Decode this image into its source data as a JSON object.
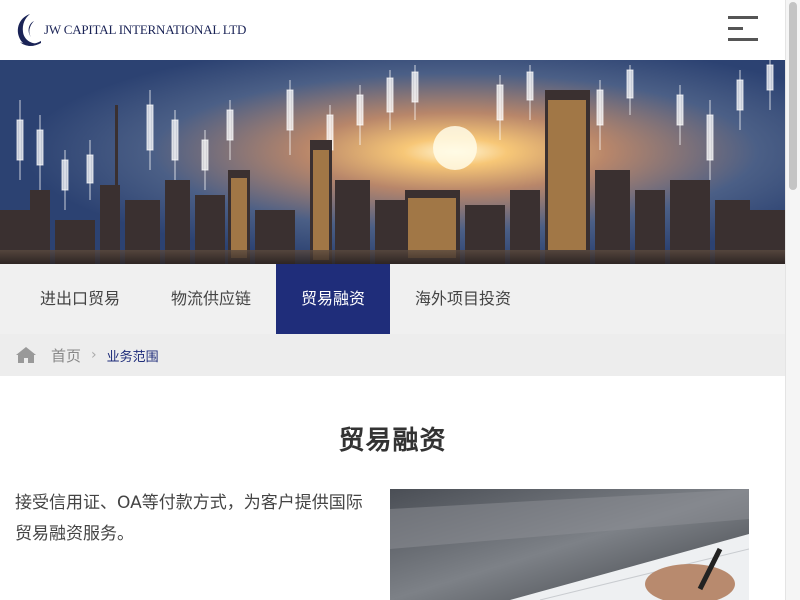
{
  "header": {
    "logo_text": "JW CAPITAL INTERNATIONAL LTD",
    "logo_icon": "crescent-logo-icon",
    "menu_icon": "hamburger-menu-icon"
  },
  "banner": {
    "description_icon": "city-skyline-with-stock-chart"
  },
  "tabs": [
    {
      "label": "进出口贸易",
      "active": false
    },
    {
      "label": "物流供应链",
      "active": false
    },
    {
      "label": "贸易融资",
      "active": true
    },
    {
      "label": "海外项目投资",
      "active": false
    }
  ],
  "breadcrumb": {
    "home_icon": "home-icon",
    "home_label": "首页",
    "separator": "›",
    "current": "业务范围"
  },
  "content": {
    "title": "贸易融资",
    "description": "接受信用证、OA等付款方式，为客户提供国际贸易融资服务。"
  },
  "colors": {
    "brand_navy": "#1f2d7a",
    "tab_bg": "#f0f0f0",
    "breadcrumb_bg": "#ededed"
  }
}
